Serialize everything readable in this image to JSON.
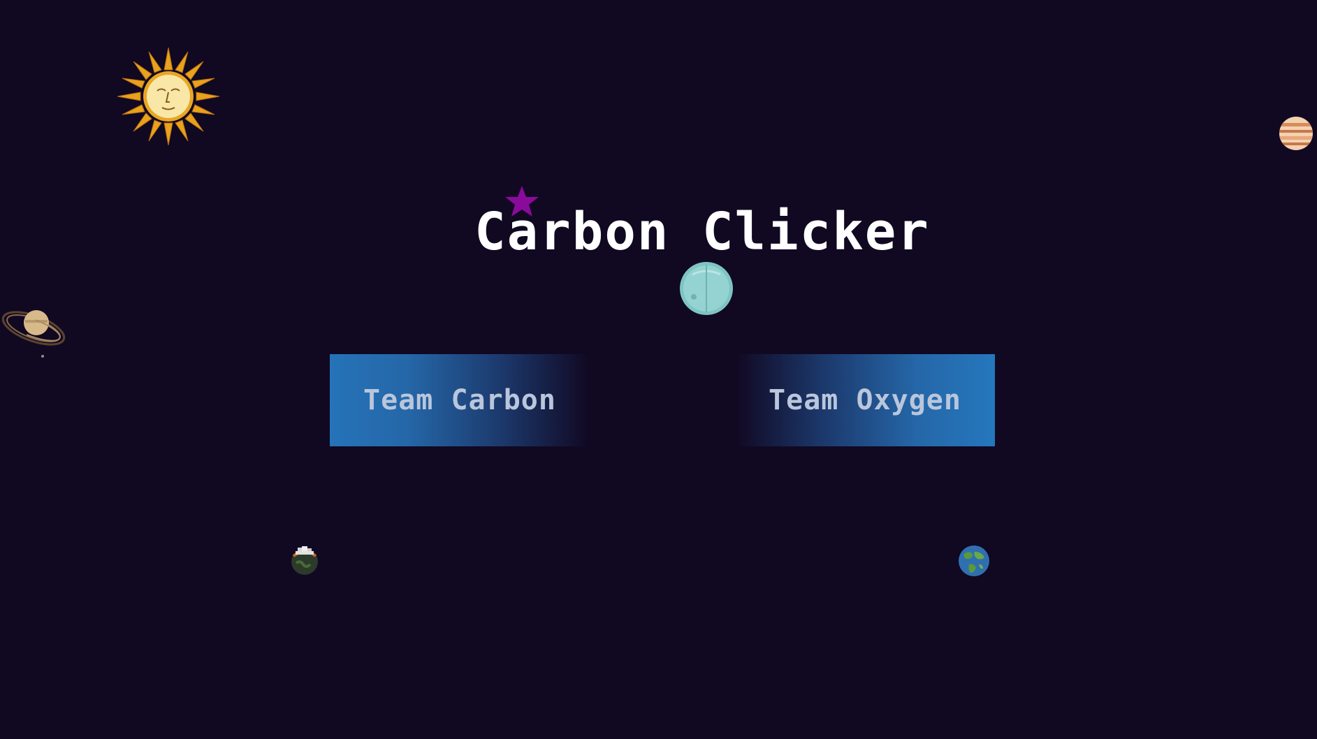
{
  "game": {
    "title": "Carbon Clicker"
  },
  "menu": {
    "team_carbon_label": "Team Carbon",
    "team_oxygen_label": "Team Oxygen"
  },
  "sprites": {
    "sun": "sun-icon",
    "jupiter": "jupiter-icon",
    "saturn": "saturn-icon",
    "star": "star-icon",
    "uranus": "uranus-icon",
    "polluted_earth": "polluted-earth-icon",
    "earth": "earth-icon"
  },
  "colors": {
    "background": "#110822",
    "button_blue": "#2573b8",
    "title": "#ffffff",
    "button_text": "#b9c6dc",
    "star": "#8a0a9c"
  }
}
